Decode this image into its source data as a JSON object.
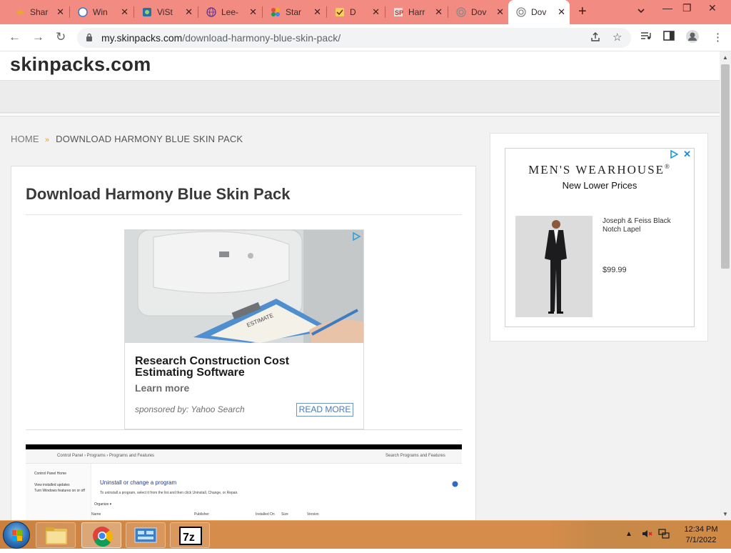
{
  "browser": {
    "tabs": [
      {
        "label": "Shar",
        "icon": "pointer-icon",
        "active": false
      },
      {
        "label": "Win",
        "icon": "chrome-generic-icon",
        "active": false
      },
      {
        "label": "ViSt",
        "icon": "vista-icon",
        "active": false
      },
      {
        "label": "Lee-",
        "icon": "globe-icon",
        "active": false
      },
      {
        "label": "Star",
        "icon": "pinwheel-icon",
        "active": false
      },
      {
        "label": "D",
        "icon": "check-icon",
        "active": false
      },
      {
        "label": "Harr",
        "icon": "sp-icon",
        "active": false
      },
      {
        "label": "Dov",
        "icon": "spiral-icon",
        "active": false
      },
      {
        "label": "Dov",
        "icon": "spiral-icon",
        "active": true
      }
    ],
    "url_domain": "my.skinpacks.com",
    "url_path": "/download-harmony-blue-skin-pack/"
  },
  "site": {
    "logo": "skinpacks.com"
  },
  "breadcrumb": {
    "home": "HOME",
    "current": "DOWNLOAD HARMONY BLUE SKIN PACK"
  },
  "post": {
    "title": "Download Harmony Blue Skin Pack"
  },
  "ad": {
    "headline": "Research Construction Cost Estimating Software",
    "learn_more": "Learn more",
    "sponsor": "sponsored by: Yahoo Search",
    "read_more": "READ MORE",
    "clipboard_text": "ESTIMATE"
  },
  "screenshot_embed": {
    "breadcrumb": "Control Panel  ›  Programs  ›  Programs and Features",
    "search_placeholder": "Search Programs and Features",
    "side_links": [
      "Control Panel Home",
      "View installed updates",
      "Turn Windows features on or off"
    ],
    "heading": "Uninstall or change a program",
    "subtext": "To uninstall a program, select it from the list and then click Uninstall, Change, or Repair.",
    "organize": "Organize ▾",
    "columns": [
      "Name",
      "Publisher",
      "Installed On",
      "Size",
      "Version"
    ]
  },
  "sidebar_ad": {
    "brand": "MEN'S WEARHOUSE",
    "registered": "®",
    "tagline": "New Lower Prices",
    "product": "Joseph & Feiss Black Notch Lapel",
    "price": "$99.99"
  },
  "taskbar": {
    "apps": [
      "File Explorer",
      "Google Chrome",
      "Control Panel",
      "7-Zip"
    ],
    "time": "12:34 PM",
    "date": "7/1/2022"
  },
  "colors": {
    "tab_strip": "#f28b82",
    "taskbar": "#d68c4a",
    "breadcrumb_separator": "#f0a030",
    "ad_read_more": "#4f79b5"
  }
}
